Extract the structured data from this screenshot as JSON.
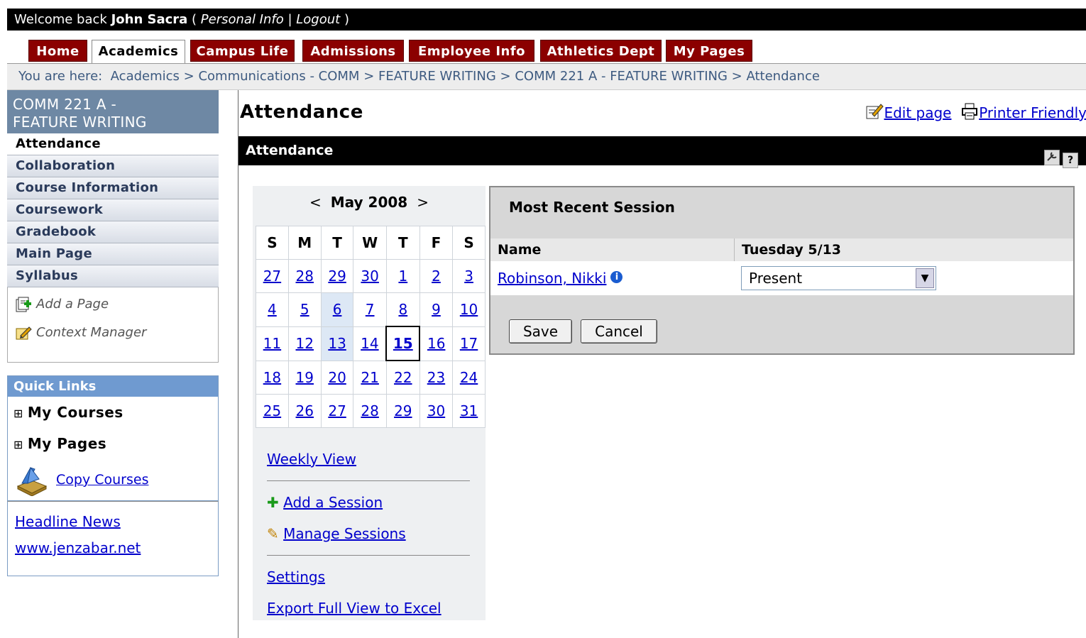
{
  "welcome": {
    "prefix": "Welcome back ",
    "user": "John Sacra",
    "open": " ( ",
    "personal_info": "Personal Info",
    "pipe": " | ",
    "logout": "Logout",
    "close": " )"
  },
  "tabs": [
    "Home",
    "Academics",
    "Campus Life",
    "Admissions",
    "Employee Info",
    "Athletics Dept",
    "My Pages"
  ],
  "active_tab": "Academics",
  "breadcrumb": {
    "prefix": "You are here:",
    "items": [
      "Academics",
      "Communications - COMM",
      "FEATURE WRITING",
      "COMM 221 A - FEATURE WRITING",
      "Attendance"
    ],
    "separator": ">"
  },
  "sidebar": {
    "course_title_line1": "COMM 221 A -",
    "course_title_line2": "FEATURE WRITING",
    "items": [
      "Attendance",
      "Collaboration",
      "Course Information",
      "Coursework",
      "Gradebook",
      "Main Page",
      "Syllabus"
    ],
    "tools": [
      "Add a Page",
      "Context Manager"
    ]
  },
  "quick_links": {
    "header": "Quick Links",
    "items": [
      "My Courses",
      "My Pages"
    ],
    "expander": "⊞",
    "copy_courses": "Copy Courses",
    "news": [
      "Headline News",
      "www.jenzabar.net"
    ]
  },
  "main": {
    "page_title": "Attendance",
    "edit_page": "Edit page",
    "printer_friendly": "Printer Friendly",
    "portlet_title": "Attendance",
    "portlet_help": "?"
  },
  "calendar": {
    "month": "May 2008",
    "prev": "<",
    "next": ">",
    "weekdays": [
      "S",
      "M",
      "T",
      "W",
      "T",
      "F",
      "S"
    ],
    "weeks": [
      [
        "27",
        "28",
        "29",
        "30",
        "1",
        "2",
        "3"
      ],
      [
        "4",
        "5",
        "6",
        "7",
        "8",
        "9",
        "10"
      ],
      [
        "11",
        "12",
        "13",
        "14",
        "15",
        "16",
        "17"
      ],
      [
        "18",
        "19",
        "20",
        "21",
        "22",
        "23",
        "24"
      ],
      [
        "25",
        "26",
        "27",
        "28",
        "29",
        "30",
        "31"
      ]
    ],
    "today": "15",
    "weekly_view": "Weekly View",
    "add_session": "Add a Session",
    "manage_sessions": "Manage Sessions",
    "settings": "Settings",
    "export": "Export Full View to Excel"
  },
  "session": {
    "header": "Most Recent Session",
    "col_name": "Name",
    "col_date": "Tuesday 5/13",
    "student": "Robinson, Nikki",
    "info_icon": "i",
    "status": "Present",
    "save": "Save",
    "cancel": "Cancel"
  },
  "colors": {
    "tab_bg": "#8b0000",
    "course_title_bg": "#6e88a4",
    "quick_links_bg": "#6f9ad0",
    "link": "#0000cc"
  }
}
